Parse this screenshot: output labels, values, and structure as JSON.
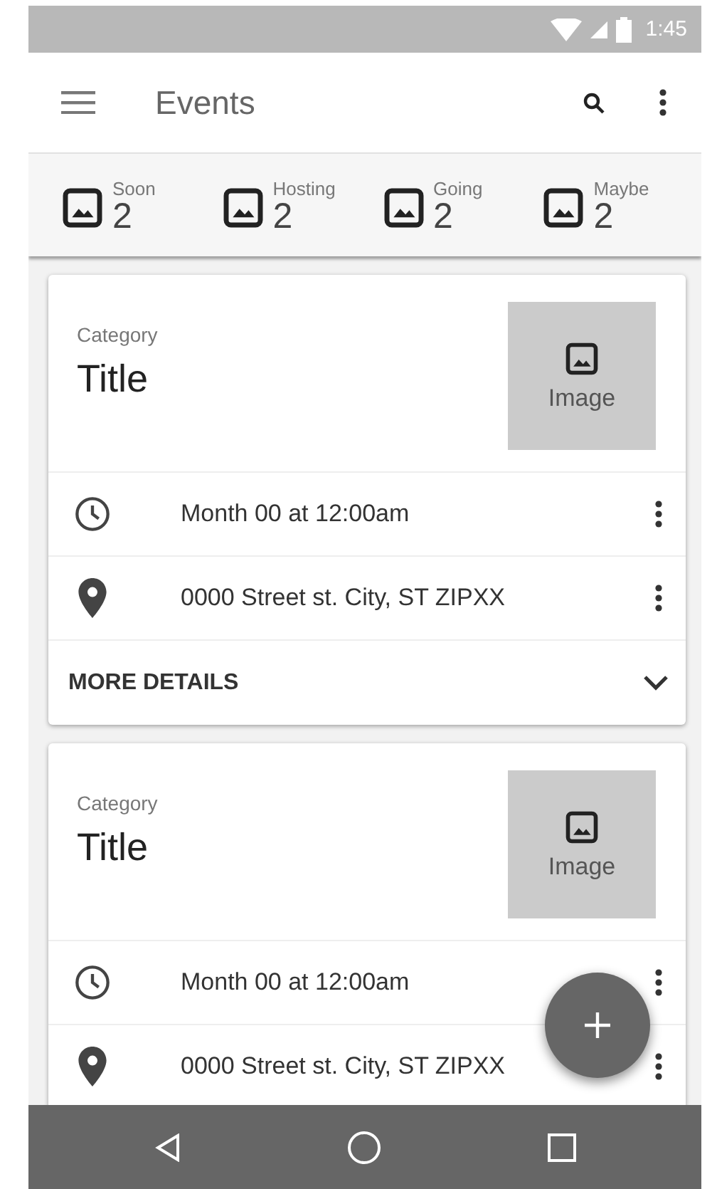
{
  "status_bar": {
    "time": "1:45"
  },
  "app_bar": {
    "title": "Events"
  },
  "tabs": [
    {
      "label": "Soon",
      "count": "2"
    },
    {
      "label": "Hosting",
      "count": "2"
    },
    {
      "label": "Going",
      "count": "2"
    },
    {
      "label": "Maybe",
      "count": "2"
    }
  ],
  "cards": [
    {
      "category": "Category",
      "title": "Title",
      "image_label": "Image",
      "rows": [
        {
          "kind": "time",
          "text": "Month 00 at 12:00am"
        },
        {
          "kind": "location",
          "text": "0000 Street st. City, ST ZIPXX"
        }
      ],
      "footer": {
        "label": "MORE DETAILS"
      }
    },
    {
      "category": "Category",
      "title": "Title",
      "image_label": "Image",
      "rows": [
        {
          "kind": "time",
          "text": "Month 00 at 12:00am"
        },
        {
          "kind": "location",
          "text": "0000 Street st. City, ST ZIPXX"
        }
      ]
    }
  ]
}
